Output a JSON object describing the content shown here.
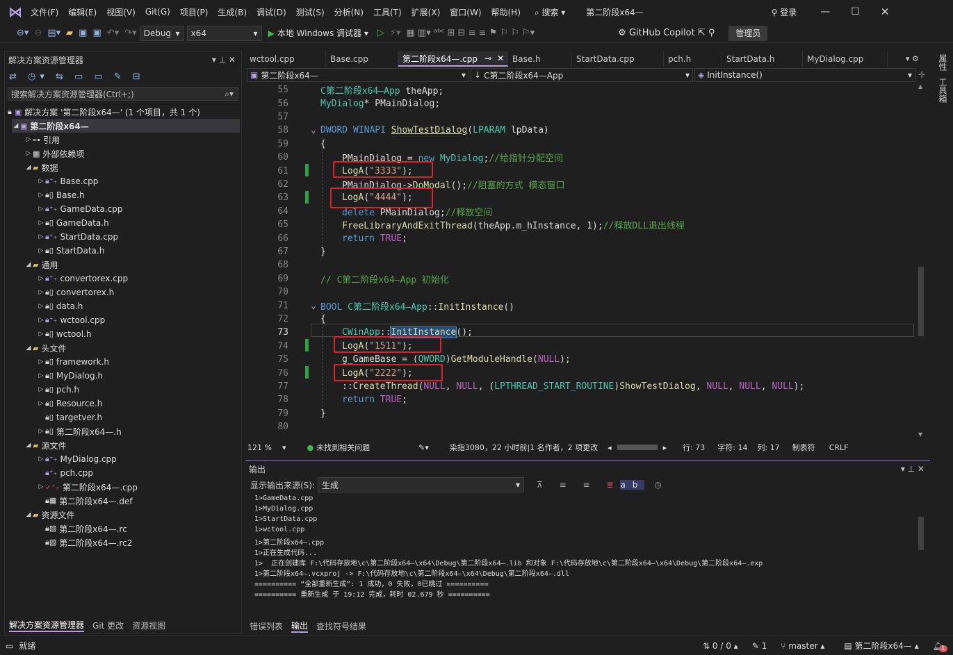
{
  "menu": {
    "items": [
      "文件(F)",
      "编辑(E)",
      "视图(V)",
      "Git(G)",
      "项目(P)",
      "生成(B)",
      "调试(D)",
      "测试(S)",
      "分析(N)",
      "工具(T)",
      "扩展(X)",
      "窗口(W)",
      "帮助(H)"
    ],
    "search": "搜索",
    "title": "第二阶段x64—",
    "login": "登录"
  },
  "toolbar": {
    "config": "Debug",
    "platform": "x64",
    "run": "本地 Windows 调试器",
    "copilot": "GitHub Copilot",
    "admin": "管理员"
  },
  "solution_explorer": {
    "title": "解决方案资源管理器",
    "search_placeholder": "搜索解决方案资源管理器(Ctrl+;)",
    "solution": "解决方案 '第二阶段x64—' (1 个项目，共 1 个)",
    "project": "第二阶段x64—",
    "nodes": [
      "引用",
      "外部依赖项",
      "数据",
      "Base.cpp",
      "Base.h",
      "GameData.cpp",
      "GameData.h",
      "StartData.cpp",
      "StartData.h",
      "通用",
      "convertorex.cpp",
      "convertorex.h",
      "data.h",
      "wctool.cpp",
      "wctool.h",
      "头文件",
      "framework.h",
      "MyDialog.h",
      "pch.h",
      "Resource.h",
      "targetver.h",
      "第二阶段x64—.h",
      "源文件",
      "MyDialog.cpp",
      "pch.cpp",
      "第二阶段x64—.cpp",
      "第二阶段x64—.def",
      "资源文件",
      "第二阶段x64—.rc",
      "第二阶段x64—.rc2"
    ],
    "bottom_tabs": [
      "解决方案资源管理器",
      "Git 更改",
      "资源视图"
    ]
  },
  "editor": {
    "tabs": [
      "wctool.cpp",
      "Base.cpp",
      "第二阶段x64—.cpp",
      "Base.h",
      "StartData.cpp",
      "pch.h",
      "StartData.h",
      "MyDialog.cpp"
    ],
    "nav_project": "第二阶段x64—",
    "nav_class": "C第二阶段x64—App",
    "nav_member": "InitInstance()",
    "line_numbers": [
      "55",
      "56",
      "57",
      "58",
      "59",
      "60",
      "61",
      "62",
      "63",
      "64",
      "65",
      "66",
      "67",
      "68",
      "69",
      "70",
      "71",
      "72",
      "73",
      "74",
      "75",
      "76",
      "77",
      "78",
      "79",
      "80"
    ],
    "code_text": {
      "l55a": "C第二阶段x64—App",
      "l55b": " theApp;",
      "l56a": "MyDialog",
      "l56b": "* PMainDialog;",
      "l58a": "DWORD WINAPI ",
      "l58b": "ShowTestDialog",
      "l58c": "(",
      "l58d": "LPARAM",
      "l58e": " lpData)",
      "l59": "{",
      "l60a": "PMainDialog = ",
      "l60b": "new",
      "l60c": " ",
      "l60d": "MyDialog",
      "l60e": ";",
      "l60f": "//给指针分配空间",
      "l61a": "LogA",
      "l61b": "(",
      "l61c": "\"3333\"",
      "l61d": ");",
      "l62a": "PMainDialog->",
      "l62b": "DoModal",
      "l62c": "();",
      "l62d": "//阻塞的方式 模态窗口",
      "l63a": "LogA",
      "l63b": "(",
      "l63c": "\"4444\"",
      "l63d": ");",
      "l64a": "delete",
      "l64b": " PMainDialog;",
      "l64c": "//释放空间",
      "l65a": "FreeLibraryAndExitThread",
      "l65b": "(theApp.m_hInstance, 1);",
      "l65c": "//释放DLL退出线程",
      "l66a": "return",
      "l66b": " ",
      "l66c": "TRUE",
      "l66d": ";",
      "l67": "}",
      "l69": "// C第二阶段x64—App 初始化",
      "l71a": "BOOL",
      "l71b": " ",
      "l71c": "C第二阶段x64—App",
      "l71d": "::",
      "l71e": "InitInstance",
      "l71f": "()",
      "l72": "{",
      "l73a": "CWinApp",
      "l73b": "::",
      "l73c": "InitInstance",
      "l73d": "();",
      "l74a": "LogA",
      "l74b": "(",
      "l74c": "\"1511\"",
      "l74d": ");",
      "l75a": "g_GameBase",
      "l75b": " = (",
      "l75c": "QWORD",
      "l75d": ")",
      "l75e": "GetModuleHandle",
      "l75f": "(",
      "l75g": "NULL",
      "l75h": ");",
      "l76a": "LogA",
      "l76b": "(",
      "l76c": "\"2222\"",
      "l76d": ");",
      "l77a": "::",
      "l77b": "CreateThread",
      "l77c": "(",
      "l77d": "NULL",
      "l77e": ", ",
      "l77f": "NULL",
      "l77g": ", (",
      "l77h": "LPTHREAD_START_ROUTINE",
      "l77i": ")",
      "l77j": "ShowTestDialog",
      "l77k": ", ",
      "l77l": "NULL",
      "l77m": ", ",
      "l77n": "NULL",
      "l77o": ", ",
      "l77p": "NULL",
      "l77q": ");",
      "l78a": "return",
      "l78b": " ",
      "l78c": "TRUE",
      "l78d": ";",
      "l79": "}"
    },
    "status": {
      "zoom": "121 %",
      "issues": "未找到相关问题",
      "git_info": "染指3080，22 小时前|1 名作者，2 项更改",
      "line": "行: 73",
      "char": "字符: 14",
      "col": "列: 17",
      "tabs": "制表符",
      "eol": "CRLF"
    }
  },
  "output": {
    "title": "输出",
    "source_label": "显示输出来源(S):",
    "source_value": "生成",
    "lines": [
      "1>GameData.cpp",
      "1>MyDialog.cpp",
      "1>StartData.cpp",
      "1>wctool.cpp",
      "1>第二阶段x64—.cpp",
      "1>正在生成代码...",
      "1>  正在创建库 F:\\代码存放地\\c\\第二阶段x64—\\x64\\Debug\\第二阶段x64—.lib 和对象 F:\\代码存放地\\c\\第二阶段x64—\\x64\\Debug\\第二阶段x64—.exp",
      "1>第二阶段x64—.vcxproj -> F:\\代码存放地\\c\\第二阶段x64—\\x64\\Debug\\第二阶段x64—.dll",
      "========== “全部重新生成”: 1 成功，0 失败，0已跳过 ==========",
      "========== 重新生成 于 19:12 完成，耗时 02.679 秒 =========="
    ],
    "bottom_tabs": [
      "错误列表",
      "输出",
      "查找符号结果"
    ]
  },
  "right_strip": [
    "属性",
    "工具箱"
  ],
  "statusbar": {
    "ready": "就绪",
    "errors": "0 / 0",
    "edits": "1",
    "branch": "master",
    "repo": "第二阶段x64—",
    "notifications": "1"
  }
}
